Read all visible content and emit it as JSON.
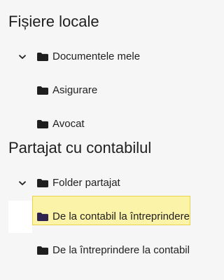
{
  "sections": [
    {
      "title": "Fișiere locale",
      "items": [
        {
          "label": "Documentele mele",
          "expanded": true,
          "level": 1
        },
        {
          "label": "Asigurare",
          "level": 2
        },
        {
          "label": "Avocat",
          "level": 2
        }
      ]
    },
    {
      "title": "Partajat cu contabilul",
      "items": [
        {
          "label": "Folder partajat",
          "expanded": true,
          "level": 1
        },
        {
          "label": "De la contabil la întreprindere",
          "level": 2,
          "selected": true
        },
        {
          "label": "De la întreprindere la contabil",
          "level": 2
        }
      ]
    }
  ],
  "colors": {
    "background": "#f6f6f6",
    "text": "#1f1f1f",
    "selected_background": "#fbf3a8",
    "selected_border": "#e8d34a",
    "folder_icon": "#1f1f1f",
    "selected_folder_icon": "#2f2450"
  },
  "icons": {
    "expand": "chevron-down-icon",
    "folder": "folder-icon"
  }
}
